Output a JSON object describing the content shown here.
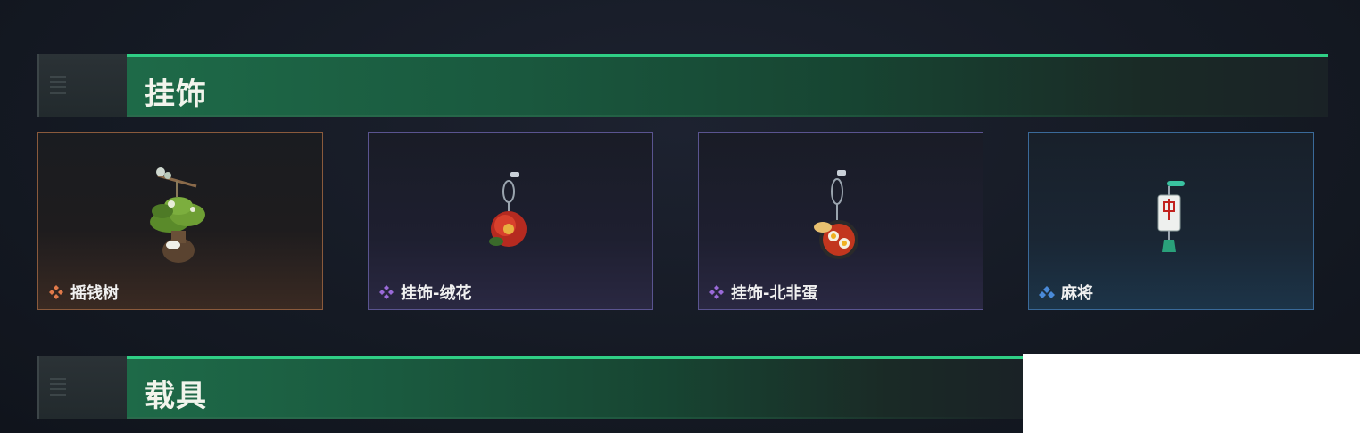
{
  "sections": [
    {
      "title": "挂饰"
    },
    {
      "title": "载具"
    }
  ],
  "items": [
    {
      "name": "摇钱树",
      "rarity": "orange",
      "rarity_color": "#e07a4a",
      "icon": "money-tree-charm-icon"
    },
    {
      "name": "挂饰-绒花",
      "rarity": "purple",
      "rarity_color": "#9a6ad8",
      "icon": "velvet-flower-charm-icon"
    },
    {
      "name": "挂饰-北非蛋",
      "rarity": "purple",
      "rarity_color": "#9a6ad8",
      "icon": "shakshuka-pan-charm-icon"
    },
    {
      "name": "麻将",
      "rarity": "blue",
      "rarity_color": "#4a8ad8",
      "icon": "mahjong-tile-charm-icon"
    }
  ],
  "colors": {
    "header_accent": "#2fcf85"
  }
}
